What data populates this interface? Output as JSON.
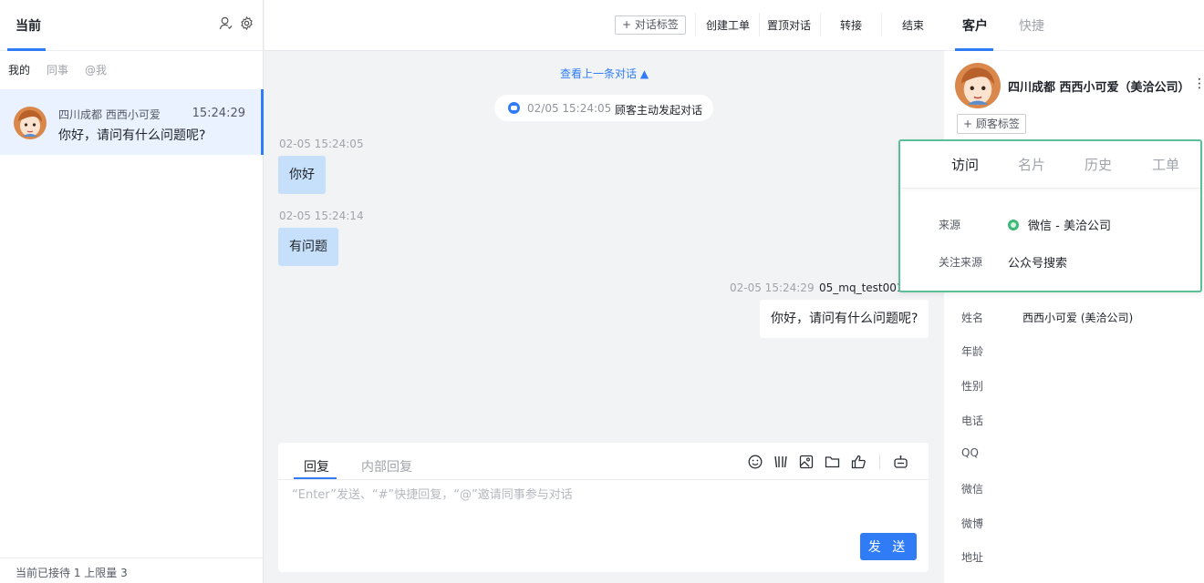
{
  "left_panel": {
    "tab_current": "当前",
    "subtabs": [
      "我的",
      "同事",
      "@我"
    ],
    "conversation": {
      "name": "四川成都  西西小可爱",
      "time": "15:24:29",
      "last_message": "你好，请问有什么问题呢?"
    },
    "footer": "当前已接待 1 上限量 3"
  },
  "topbar": {
    "tag_button": "+ 对话标签",
    "create_ticket": "创建工单",
    "pin_conversation": "置顶对话",
    "transfer": "转接",
    "end": "结束"
  },
  "chat": {
    "view_previous": "查看上一条对话 ▲",
    "system_time": "02/05 15:24:05",
    "system_text": "顾客主动发起对话",
    "messages": [
      {
        "time": "02-05 15:24:05",
        "text": "你好"
      },
      {
        "time": "02-05 15:24:14",
        "text": "有问题"
      },
      {
        "time": "02-05 15:24:29",
        "agent": "05_mq_test001",
        "text": "你好，请问有什么问题呢?"
      }
    ]
  },
  "reply": {
    "tab_reply": "回复",
    "tab_internal": "内部回复",
    "placeholder": "“Enter”发送、“#”快捷回复，“@”邀请同事参与对话",
    "send_label": "发 送"
  },
  "right_panel": {
    "tab_customer": "客户",
    "tab_quick": "快捷",
    "customer_name": "四川成都 西西小可爱（美洽公司）",
    "customer_tag_button": "+ 顾客标签",
    "fields": [
      {
        "label": "姓名",
        "value": "西西小可爱 (美洽公司)"
      },
      {
        "label": "年龄",
        "value": ""
      },
      {
        "label": "性别",
        "value": ""
      },
      {
        "label": "电话",
        "value": ""
      },
      {
        "label": "QQ",
        "value": ""
      },
      {
        "label": "微信",
        "value": ""
      },
      {
        "label": "微博",
        "value": ""
      },
      {
        "label": "地址",
        "value": ""
      }
    ]
  },
  "visit_card": {
    "tabs": [
      "访问",
      "名片",
      "历史",
      "工单"
    ],
    "source_label": "来源",
    "source_value": "微信 - 美洽公司",
    "follow_label": "关注来源",
    "follow_value": "公众号搜索"
  },
  "colors": {
    "accent": "#2f7cf6",
    "highlight_border": "#5bbf98",
    "incoming_bubble": "#c6e0fb"
  }
}
